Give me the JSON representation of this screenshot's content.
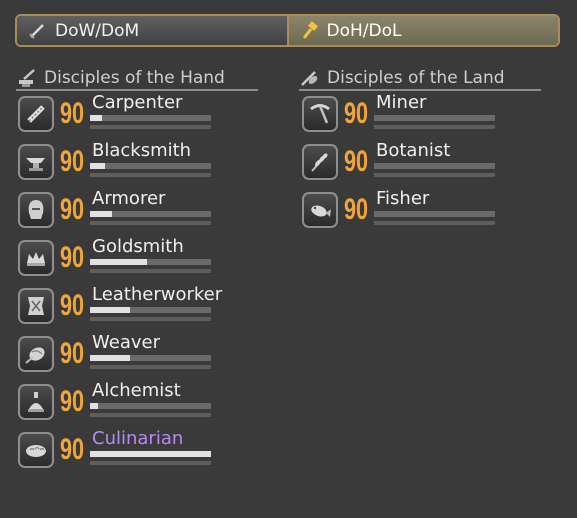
{
  "tabs": [
    {
      "label": "DoW/DoM",
      "icon": "sword-icon",
      "active": false
    },
    {
      "label": "DoH/DoL",
      "icon": "hammer-icon",
      "active": true
    }
  ],
  "hand": {
    "title": "Disciples of the Hand",
    "icon": "anvil-hammer-icon",
    "jobs": [
      {
        "name": "Carpenter",
        "level": "90",
        "icon": "saw-icon",
        "progress": 0.1
      },
      {
        "name": "Blacksmith",
        "level": "90",
        "icon": "anvil-icon",
        "progress": 0.12
      },
      {
        "name": "Armorer",
        "level": "90",
        "icon": "helmet-icon",
        "progress": 0.18
      },
      {
        "name": "Goldsmith",
        "level": "90",
        "icon": "crown-icon",
        "progress": 0.47
      },
      {
        "name": "Leatherworker",
        "level": "90",
        "icon": "leather-icon",
        "progress": 0.33
      },
      {
        "name": "Weaver",
        "level": "90",
        "icon": "yarn-icon",
        "progress": 0.33
      },
      {
        "name": "Alchemist",
        "level": "90",
        "icon": "flask-icon",
        "progress": 0.07
      },
      {
        "name": "Culinarian",
        "level": "90",
        "icon": "bread-icon",
        "progress": 1.0
      }
    ]
  },
  "land": {
    "title": "Disciples of the Land",
    "icon": "fish-tool-icon",
    "jobs": [
      {
        "name": "Miner",
        "level": "90",
        "icon": "pickaxe-icon",
        "progress": 0.0
      },
      {
        "name": "Botanist",
        "level": "90",
        "icon": "wheat-icon",
        "progress": 0.0
      },
      {
        "name": "Fisher",
        "level": "90",
        "icon": "fish-icon",
        "progress": 0.0
      }
    ]
  },
  "colors": {
    "level": "#f0a43a",
    "highlight_name": "#b58cf0",
    "frame": "#a88c5c"
  }
}
